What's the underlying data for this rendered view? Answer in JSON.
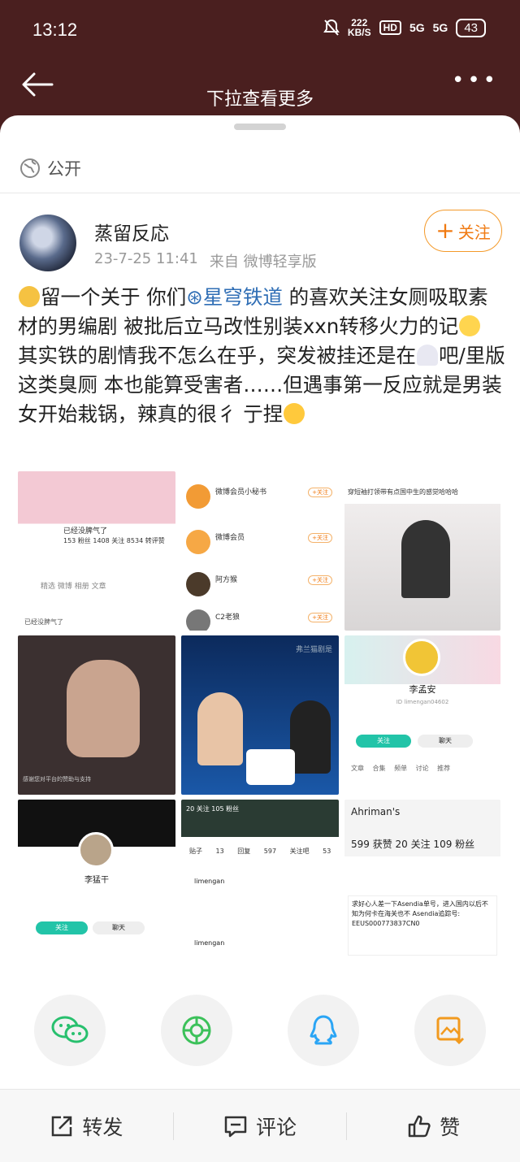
{
  "status_bar": {
    "time": "13:12",
    "speed": "222",
    "speed_unit": "KB/S",
    "hd": "HD",
    "signal1": "5G",
    "signal2": "5G",
    "battery": "43"
  },
  "nav": {
    "title": "下拉查看更多"
  },
  "visibility": "公开",
  "post": {
    "author": "蒸留反応",
    "date": "23-7-25 11:41",
    "source": "来自 微博轻享版",
    "follow_label": "关注",
    "text_1": "留一个关于 你们",
    "topic": "星穹铁道",
    "text_2": " 的喜欢关注女厕吸取素材的男编剧 被批后立马改性别装xxn转移火力的记",
    "text_3": "其实铁的剧情我不怎么在乎，突发被挂还是在",
    "text_4": "吧/里版这类臭厕 本也能算受害者……但遇事第一反应就是男装女开始栽锅，辣真的很彳 亍捏"
  },
  "images": {
    "t1": {
      "name": "已经没脾气了",
      "stats": "153 粉丝  1408 关注  8534 转评赞",
      "tabs": "精选   微博   相册   文章",
      "post": "已经没脾气了"
    },
    "t2": {
      "r1": "微博会员小秘书",
      "r2": "微博会员",
      "r3": "阿方猴",
      "r4": "C2老狼",
      "follow": "+关注"
    },
    "t3": {
      "caption": "穿短袖打领带有点国中生的感觉哈哈哈"
    },
    "t4": {
      "caption": "感谢您对平台的赞助与支持"
    },
    "t5": {
      "watermark": "弗兰猫剧是"
    },
    "t6": {
      "name": "李孟安",
      "sub": "ID limengan04602",
      "follow": "关注",
      "chat": "聊天",
      "tabs": "文章 合集 频单 讨论 推荐"
    },
    "t7": {
      "name": "李猛干",
      "follow": "关注",
      "chat": "聊天"
    },
    "t8": {
      "head": "20 关注  105 粉丝",
      "stats": "贴子 13  回复 597  关注吧 53",
      "u1": "limengan",
      "u2": "limengan"
    },
    "t9": {
      "l1": "Ahriman's",
      "l2": "599 获赞  20 关注  109 粉丝",
      "card": "求好心人差一下Asendia单号，进入国内以后不知为何卡在海关也不  Asendia追踪号: EEUS000773837CN0"
    }
  },
  "share": [
    "wechat-icon",
    "moments-icon",
    "qq-icon",
    "save-image-icon"
  ],
  "actions": {
    "repost": "转发",
    "comment": "评论",
    "like": "赞"
  }
}
